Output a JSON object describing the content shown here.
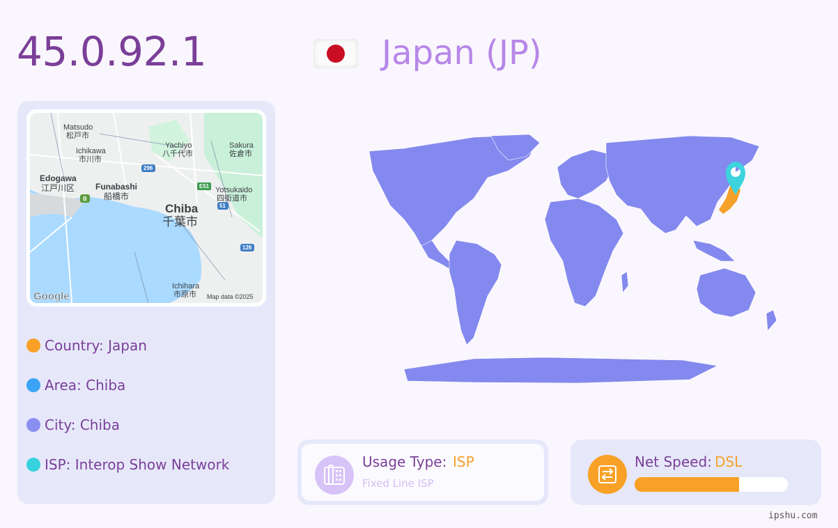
{
  "header": {
    "ip": "45.0.92.1",
    "country_title": "Japan (JP)",
    "flag_icon": "japan-flag-icon"
  },
  "map": {
    "labels": {
      "matsudo": "Matsudo",
      "matsudo_jp": "松戸市",
      "ichikawa": "Ichikawa",
      "ichikawa_jp": "市川市",
      "yachiyo": "Yachiyo",
      "yachiyo_jp": "八千代市",
      "sakura": "Sakura",
      "sakura_jp": "佐倉市",
      "edogawa": "Edogawa",
      "edogawa_jp": "江戸川区",
      "funabashi": "Funabashi",
      "funabashi_jp": "船橋市",
      "yotsukaido": "Yotsukaido",
      "yotsukaido_jp": "四街道市",
      "chiba": "Chiba",
      "chiba_jp": "千葉市",
      "ichihara": "Ichihara",
      "ichihara_jp": "市原市",
      "r296": "296",
      "e51": "E51",
      "r51": "51",
      "r126": "126",
      "b": "B"
    },
    "logo": "Google",
    "attribution": "Map data ©2025"
  },
  "info": [
    {
      "label": "Country: Japan",
      "color": "#f8a126"
    },
    {
      "label": "Area: Chiba",
      "color": "#3aa3f5"
    },
    {
      "label": "City: Chiba",
      "color": "#8a8ff0"
    },
    {
      "label": "ISP: Interop Show Network",
      "color": "#38d2de"
    }
  ],
  "world": {
    "land_color": "#8389ee",
    "highlight_color": "#f5a12a",
    "marker_color": "#3cd3de",
    "marker_icon": "location-pin-icon"
  },
  "usage": {
    "label": "Usage Type:",
    "value": "ISP",
    "sub": "Fixed Line ISP",
    "icon": "phone-icon"
  },
  "speed": {
    "label": "Net Speed:",
    "value": "DSL",
    "level": 0.68,
    "icon": "network-icon"
  },
  "watermark": "ipshu.com"
}
